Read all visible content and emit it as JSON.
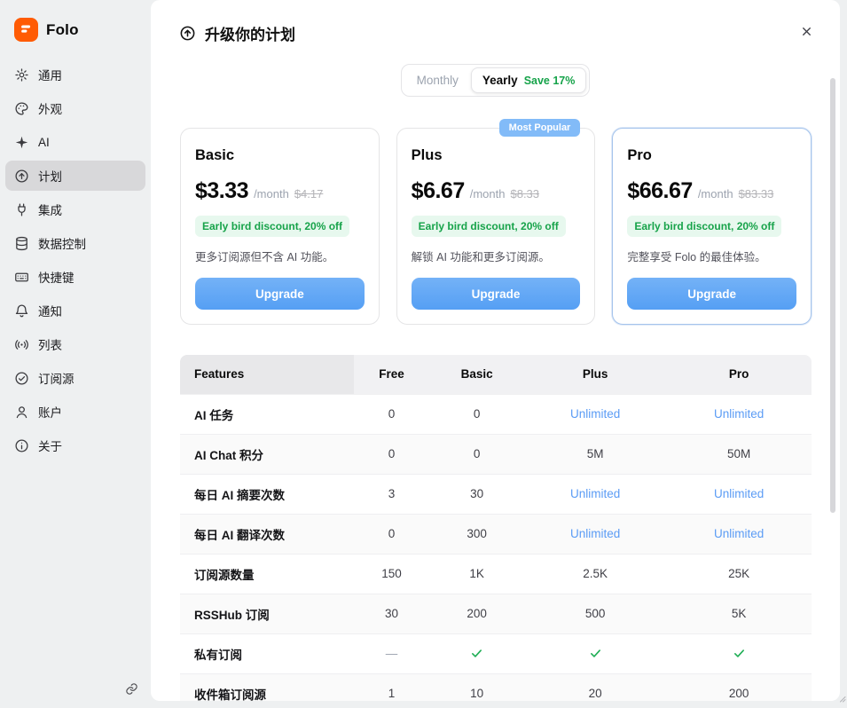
{
  "app": {
    "name": "Folo"
  },
  "sidebar": {
    "items": [
      {
        "id": "general",
        "label": "通用",
        "icon": "gear-icon",
        "active": false
      },
      {
        "id": "appearance",
        "label": "外观",
        "icon": "palette-icon",
        "active": false
      },
      {
        "id": "ai",
        "label": "AI",
        "icon": "sparkle-icon",
        "active": false
      },
      {
        "id": "plan",
        "label": "计划",
        "icon": "circle-arrow-up-icon",
        "active": true
      },
      {
        "id": "integrations",
        "label": "集成",
        "icon": "plug-icon",
        "active": false
      },
      {
        "id": "data-control",
        "label": "数据控制",
        "icon": "database-icon",
        "active": false
      },
      {
        "id": "shortcuts",
        "label": "快捷键",
        "icon": "keyboard-icon",
        "active": false
      },
      {
        "id": "notifications",
        "label": "通知",
        "icon": "bell-icon",
        "active": false
      },
      {
        "id": "lists",
        "label": "列表",
        "icon": "broadcast-icon",
        "active": false
      },
      {
        "id": "feeds",
        "label": "订阅源",
        "icon": "check-circle-icon",
        "active": false
      },
      {
        "id": "account",
        "label": "账户",
        "icon": "person-icon",
        "active": false
      },
      {
        "id": "about",
        "label": "关于",
        "icon": "info-icon",
        "active": false
      }
    ],
    "footer_icon": "link-icon"
  },
  "header": {
    "title": "升级你的计划",
    "icon": "circle-arrow-up-icon",
    "close_icon": "close-icon"
  },
  "billing_toggle": {
    "monthly": "Monthly",
    "yearly": "Yearly",
    "save": "Save 17%",
    "selected": "Yearly"
  },
  "plans": [
    {
      "name": "Basic",
      "price": "$3.33",
      "period": "/month",
      "original": "$4.17",
      "discount": "Early bird discount, 20% off",
      "description": "更多订阅源但不含 AI 功能。",
      "cta": "Upgrade",
      "badge": "",
      "highlight": false
    },
    {
      "name": "Plus",
      "price": "$6.67",
      "period": "/month",
      "original": "$8.33",
      "discount": "Early bird discount, 20% off",
      "description": "解锁 AI 功能和更多订阅源。",
      "cta": "Upgrade",
      "badge": "Most Popular",
      "highlight": false
    },
    {
      "name": "Pro",
      "price": "$66.67",
      "period": "/month",
      "original": "$83.33",
      "discount": "Early bird discount, 20% off",
      "description": "完整享受 Folo 的最佳体验。",
      "cta": "Upgrade",
      "badge": "",
      "highlight": true
    }
  ],
  "features_table": {
    "headers": [
      "Features",
      "Free",
      "Basic",
      "Plus",
      "Pro"
    ],
    "rows": [
      {
        "feature": "AI 任务",
        "values": [
          "0",
          "0",
          "Unlimited",
          "Unlimited"
        ]
      },
      {
        "feature": "AI Chat 积分",
        "values": [
          "0",
          "0",
          "5M",
          "50M"
        ]
      },
      {
        "feature": "每日 AI 摘要次数",
        "values": [
          "3",
          "30",
          "Unlimited",
          "Unlimited"
        ]
      },
      {
        "feature": "每日 AI 翻译次数",
        "values": [
          "0",
          "300",
          "Unlimited",
          "Unlimited"
        ]
      },
      {
        "feature": "订阅源数量",
        "values": [
          "150",
          "1K",
          "2.5K",
          "25K"
        ]
      },
      {
        "feature": "RSSHub 订阅",
        "values": [
          "30",
          "200",
          "500",
          "5K"
        ]
      },
      {
        "feature": "私有订阅",
        "values": [
          "—",
          "check",
          "check",
          "check"
        ]
      },
      {
        "feature": "收件箱订阅源",
        "values": [
          "1",
          "10",
          "20",
          "200"
        ]
      }
    ]
  },
  "colors": {
    "brand_orange": "#ff5b04",
    "accent_blue": "#579ef4",
    "unlimited_blue": "#5b9cf5",
    "success_green": "#16a34a",
    "discount_bg": "#e7f8ee",
    "active_item_bg": "#d8d8da"
  }
}
